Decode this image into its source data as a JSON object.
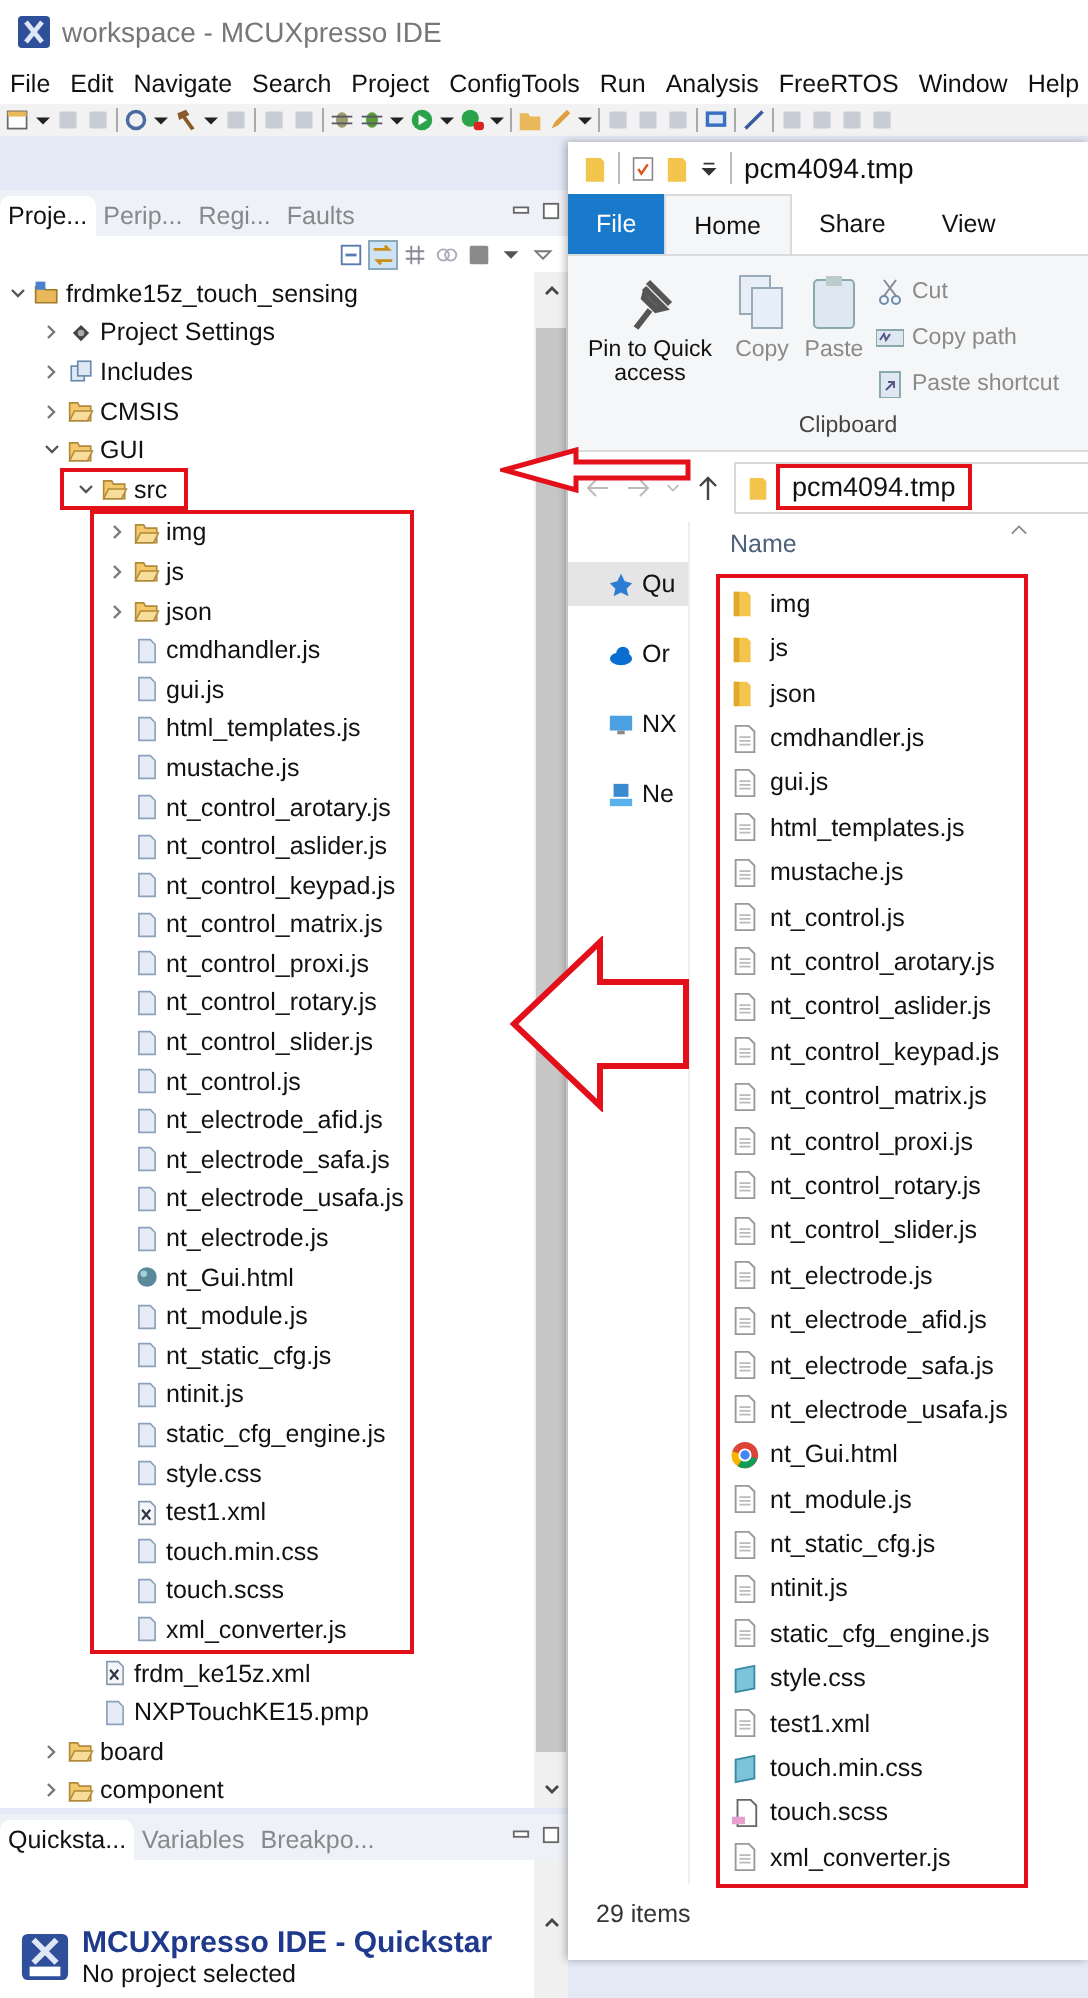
{
  "window": {
    "title": "workspace - MCUXpresso IDE"
  },
  "menu": [
    "File",
    "Edit",
    "Navigate",
    "Search",
    "Project",
    "ConfigTools",
    "Run",
    "Analysis",
    "FreeRTOS",
    "Window",
    "Help"
  ],
  "project_view": {
    "tabs": [
      {
        "label": "Proje...",
        "selected": true
      },
      {
        "label": "Perip...",
        "selected": false
      },
      {
        "label": "Regi...",
        "selected": false
      },
      {
        "label": "Faults",
        "selected": false
      }
    ],
    "tree": [
      {
        "label": "frdmke15z_touch_sensing",
        "kind": "project",
        "expanded": true,
        "children": [
          {
            "label": "Project Settings",
            "kind": "settings",
            "expanded": false
          },
          {
            "label": "Includes",
            "kind": "includes",
            "expanded": false
          },
          {
            "label": "CMSIS",
            "kind": "folder",
            "expanded": false
          },
          {
            "label": "GUI",
            "kind": "folder",
            "expanded": true,
            "children": [
              {
                "label": "src",
                "kind": "folder",
                "expanded": true,
                "highlighted": true,
                "children": [
                  {
                    "label": "img",
                    "kind": "folder",
                    "expanded": false
                  },
                  {
                    "label": "js",
                    "kind": "folder",
                    "expanded": false
                  },
                  {
                    "label": "json",
                    "kind": "folder",
                    "expanded": false
                  },
                  {
                    "label": "cmdhandler.js",
                    "kind": "file"
                  },
                  {
                    "label": "gui.js",
                    "kind": "file"
                  },
                  {
                    "label": "html_templates.js",
                    "kind": "file"
                  },
                  {
                    "label": "mustache.js",
                    "kind": "file"
                  },
                  {
                    "label": "nt_control_arotary.js",
                    "kind": "file"
                  },
                  {
                    "label": "nt_control_aslider.js",
                    "kind": "file"
                  },
                  {
                    "label": "nt_control_keypad.js",
                    "kind": "file"
                  },
                  {
                    "label": "nt_control_matrix.js",
                    "kind": "file"
                  },
                  {
                    "label": "nt_control_proxi.js",
                    "kind": "file"
                  },
                  {
                    "label": "nt_control_rotary.js",
                    "kind": "file"
                  },
                  {
                    "label": "nt_control_slider.js",
                    "kind": "file"
                  },
                  {
                    "label": "nt_control.js",
                    "kind": "file"
                  },
                  {
                    "label": "nt_electrode_afid.js",
                    "kind": "file"
                  },
                  {
                    "label": "nt_electrode_safa.js",
                    "kind": "file"
                  },
                  {
                    "label": "nt_electrode_usafa.js",
                    "kind": "file"
                  },
                  {
                    "label": "nt_electrode.js",
                    "kind": "file"
                  },
                  {
                    "label": "nt_Gui.html",
                    "kind": "html"
                  },
                  {
                    "label": "nt_module.js",
                    "kind": "file"
                  },
                  {
                    "label": "nt_static_cfg.js",
                    "kind": "file"
                  },
                  {
                    "label": "ntinit.js",
                    "kind": "file"
                  },
                  {
                    "label": "static_cfg_engine.js",
                    "kind": "file"
                  },
                  {
                    "label": "style.css",
                    "kind": "file"
                  },
                  {
                    "label": "test1.xml",
                    "kind": "xml"
                  },
                  {
                    "label": "touch.min.css",
                    "kind": "file"
                  },
                  {
                    "label": "touch.scss",
                    "kind": "file"
                  },
                  {
                    "label": "xml_converter.js",
                    "kind": "file"
                  }
                ]
              },
              {
                "label": "frdm_ke15z.xml",
                "kind": "xml"
              },
              {
                "label": "NXPTouchKE15.pmp",
                "kind": "file"
              }
            ]
          },
          {
            "label": "board",
            "kind": "folder",
            "expanded": false
          },
          {
            "label": "component",
            "kind": "folder",
            "expanded": false
          }
        ]
      }
    ]
  },
  "quickstart_view": {
    "tabs": [
      {
        "label": "Quicksta...",
        "selected": true
      },
      {
        "label": "Variables",
        "selected": false
      },
      {
        "label": "Breakpo...",
        "selected": false
      }
    ],
    "heading": "MCUXpresso IDE - Quickstar",
    "subtitle": "No project selected"
  },
  "explorer": {
    "title": "pcm4094.tmp",
    "ribbon_tabs": [
      {
        "label": "File",
        "kind": "menu",
        "selected": false
      },
      {
        "label": "Home",
        "kind": "tab",
        "selected": true
      },
      {
        "label": "Share",
        "kind": "tab",
        "selected": false
      },
      {
        "label": "View",
        "kind": "tab",
        "selected": false
      }
    ],
    "large_commands": [
      {
        "label": "Pin to Quick access",
        "kind": "pin",
        "disabled": false
      },
      {
        "label": "Copy",
        "kind": "copy",
        "disabled": true
      },
      {
        "label": "Paste",
        "kind": "paste",
        "disabled": true
      }
    ],
    "small_commands": [
      {
        "label": "Cut",
        "kind": "cut",
        "disabled": true
      },
      {
        "label": "Copy path",
        "kind": "path",
        "disabled": true
      },
      {
        "label": "Paste shortcut",
        "kind": "shortcut",
        "disabled": true
      }
    ],
    "group_label": "Clipboard",
    "address": {
      "text": "pcm4094.tmp",
      "highlighted": true
    },
    "nav_items": [
      {
        "label": "Qu",
        "kind": "quick",
        "selected": true
      },
      {
        "label": "Or",
        "kind": "cloud",
        "selected": false
      },
      {
        "label": "NX",
        "kind": "computer",
        "selected": false
      },
      {
        "label": "Ne",
        "kind": "network",
        "selected": false
      }
    ],
    "column": "Name",
    "files_highlighted": true,
    "files": [
      {
        "name": "img",
        "kind": "folder"
      },
      {
        "name": "js",
        "kind": "folder"
      },
      {
        "name": "json",
        "kind": "folder"
      },
      {
        "name": "cmdhandler.js",
        "kind": "file"
      },
      {
        "name": "gui.js",
        "kind": "file"
      },
      {
        "name": "html_templates.js",
        "kind": "file"
      },
      {
        "name": "mustache.js",
        "kind": "file"
      },
      {
        "name": "nt_control.js",
        "kind": "file"
      },
      {
        "name": "nt_control_arotary.js",
        "kind": "file"
      },
      {
        "name": "nt_control_aslider.js",
        "kind": "file"
      },
      {
        "name": "nt_control_keypad.js",
        "kind": "file"
      },
      {
        "name": "nt_control_matrix.js",
        "kind": "file"
      },
      {
        "name": "nt_control_proxi.js",
        "kind": "file"
      },
      {
        "name": "nt_control_rotary.js",
        "kind": "file"
      },
      {
        "name": "nt_control_slider.js",
        "kind": "file"
      },
      {
        "name": "nt_electrode.js",
        "kind": "file"
      },
      {
        "name": "nt_electrode_afid.js",
        "kind": "file"
      },
      {
        "name": "nt_electrode_safa.js",
        "kind": "file"
      },
      {
        "name": "nt_electrode_usafa.js",
        "kind": "file"
      },
      {
        "name": "nt_Gui.html",
        "kind": "browser"
      },
      {
        "name": "nt_module.js",
        "kind": "file"
      },
      {
        "name": "nt_static_cfg.js",
        "kind": "file"
      },
      {
        "name": "ntinit.js",
        "kind": "file"
      },
      {
        "name": "static_cfg_engine.js",
        "kind": "file"
      },
      {
        "name": "style.css",
        "kind": "css"
      },
      {
        "name": "test1.xml",
        "kind": "file"
      },
      {
        "name": "touch.min.css",
        "kind": "css"
      },
      {
        "name": "touch.scss",
        "kind": "scss"
      },
      {
        "name": "xml_converter.js",
        "kind": "file"
      }
    ],
    "status": "29 items"
  }
}
